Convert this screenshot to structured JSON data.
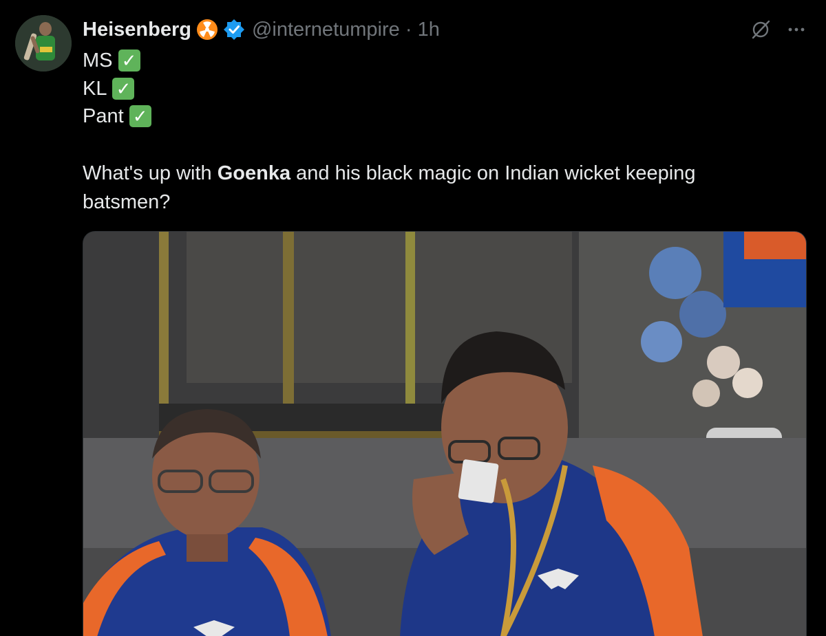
{
  "author": {
    "display_name": "Heisenberg",
    "handle": "@internetumpire",
    "separator": "·",
    "time": "1h",
    "badges": [
      "radioactive-badge-icon",
      "verified-badge-icon"
    ]
  },
  "top_icons": [
    "grok-icon",
    "more-options-icon"
  ],
  "tweet": {
    "checklist": [
      {
        "label": "MS",
        "mark": "✓"
      },
      {
        "label": "KL",
        "mark": "✓"
      },
      {
        "label": "Pant",
        "mark": "✓"
      }
    ],
    "para_before": "What's up with ",
    "para_bold": "Goenka",
    "para_after": " and his black magic on Indian wicket keeping batsmen?"
  },
  "media": {
    "description_icon": "photo"
  },
  "colors": {
    "background": "#000000",
    "text": "#e7e9ea",
    "secondary": "#71767b",
    "verified": "#1d9bf0",
    "radioactive": "#ff8c1a",
    "check": "#5fb35a",
    "team_blue": "#1f3a8f",
    "team_orange": "#e8682a"
  }
}
